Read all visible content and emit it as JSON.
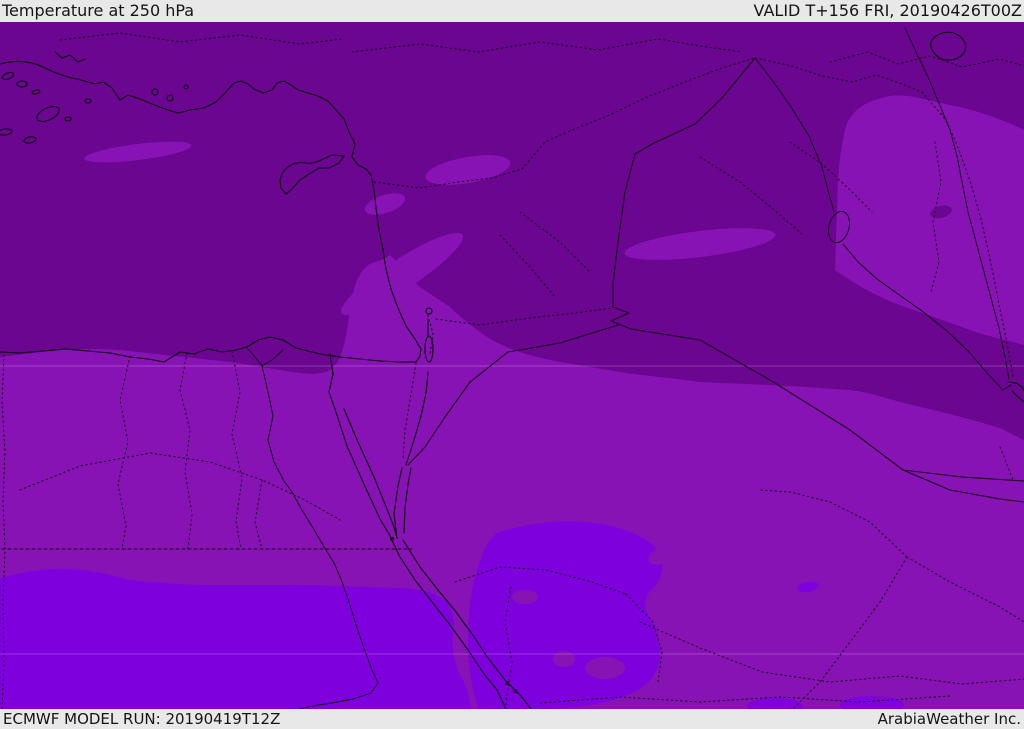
{
  "header": {
    "title": "Temperature at 250 hPa",
    "valid": "VALID T+156 FRI, 20190426T00Z"
  },
  "footer": {
    "model_run": "ECMWF MODEL RUN: 20190419T12Z",
    "branding": "ArabiaWeather Inc."
  },
  "map": {
    "description_fields": {
      "parameter": "Temperature",
      "level": "250 hPa",
      "model": "ECMWF"
    },
    "colors": {
      "band_cold": "#6A0690",
      "band_mid": "#8813B5",
      "band_warm": "#7E00DC",
      "coastline": "#0E0010",
      "border": "#1A051A",
      "river": "#0E0010",
      "gridline": "rgba(255,255,255,0.22)",
      "bars_bg": "#E9E8E8",
      "text": "#141414"
    }
  }
}
